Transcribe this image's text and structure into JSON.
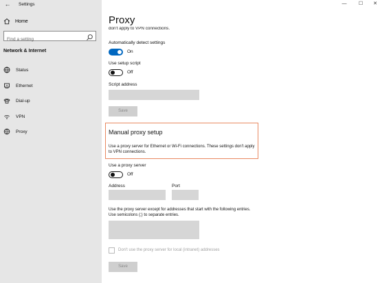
{
  "window": {
    "title": "Settings",
    "back_glyph": "←",
    "minimize": "—",
    "maximize": "☐",
    "close": "✕"
  },
  "sidebar": {
    "home_label": "Home",
    "search_placeholder": "Find a setting",
    "section_title": "Network & Internet",
    "items": [
      {
        "label": "Status",
        "icon": "status-icon"
      },
      {
        "label": "Ethernet",
        "icon": "ethernet-icon"
      },
      {
        "label": "Dial-up",
        "icon": "dialup-icon"
      },
      {
        "label": "VPN",
        "icon": "vpn-icon"
      },
      {
        "label": "Proxy",
        "icon": "proxy-icon"
      }
    ]
  },
  "main": {
    "title": "Proxy",
    "cut_text": "don't apply to VPN connections.",
    "auto": {
      "label": "Automatically detect settings",
      "state": "On"
    },
    "script": {
      "label": "Use setup script",
      "state": "Off"
    },
    "script_address_label": "Script address",
    "save_label": "Save",
    "manual": {
      "title": "Manual proxy setup",
      "desc": "Use a proxy server for Ethernet or Wi-Fi connections. These settings don't apply to VPN connections."
    },
    "use_proxy": {
      "label": "Use a proxy server",
      "state": "Off"
    },
    "address_label": "Address",
    "port_label": "Port",
    "exceptions_text": "Use the proxy server except for addresses that start with the following entries. Use semicolons (;) to separate entries.",
    "local_checkbox_label": "Don't use the proxy server for local (intranet) addresses",
    "save2_label": "Save"
  },
  "colors": {
    "accent": "#0067c0",
    "highlight_border": "#e8875e",
    "sidebar_bg": "#e6e6e6"
  }
}
